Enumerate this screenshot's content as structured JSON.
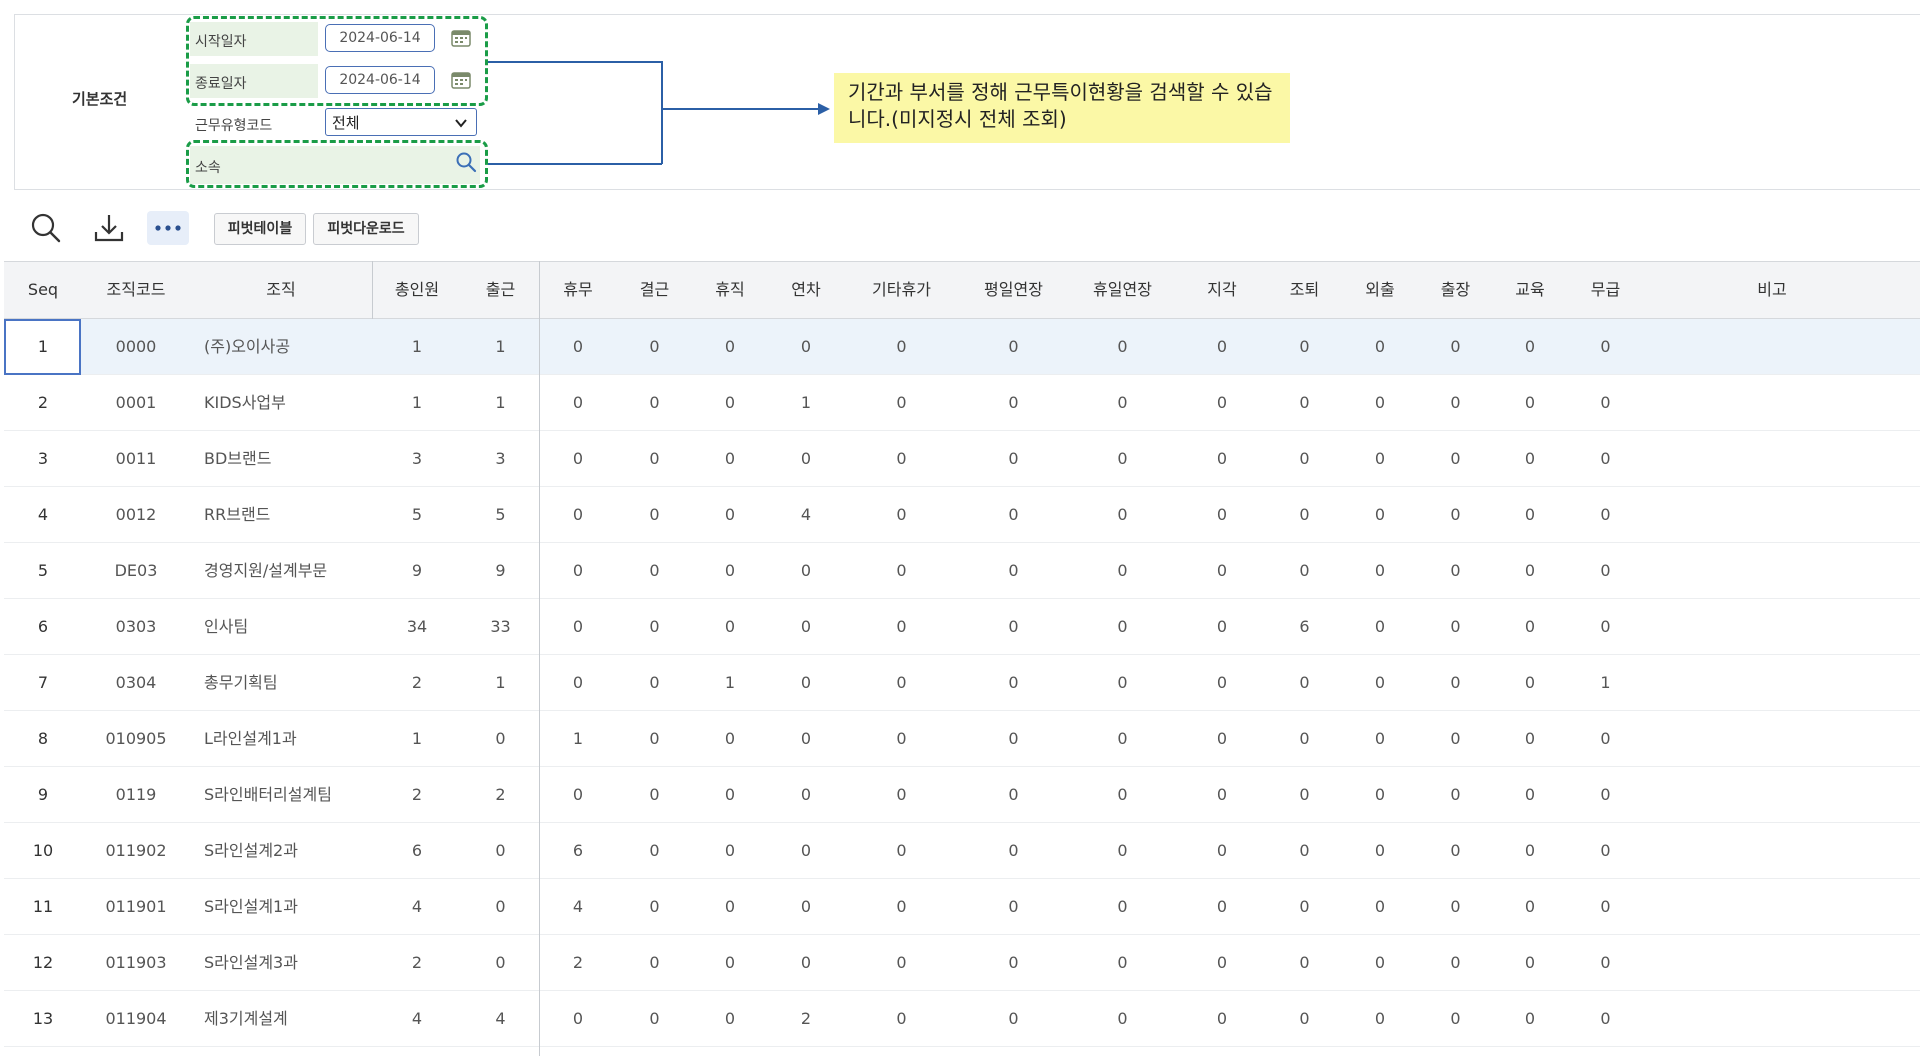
{
  "search": {
    "section_title": "기본조건",
    "start_date_label": "시작일자",
    "start_date_value": "2024-06-14",
    "end_date_label": "종료일자",
    "end_date_value": "2024-06-14",
    "work_type_label": "근무유형코드",
    "work_type_value": "전체",
    "org_label": "소속",
    "org_value": ""
  },
  "callout": {
    "text": "기간과 부서를 정해 근무특이현황을 검색할 수 있습니다.(미지정시 전체 조회)"
  },
  "toolbar": {
    "pivot_table_label": "피벗테이블",
    "pivot_download_label": "피벗다운로드"
  },
  "colors": {
    "accent_blue": "#4a6fb5",
    "highlight_green": "#1a9c47",
    "callout_yellow": "#fbf8a6",
    "selected_row": "#ecf3fa"
  },
  "grid": {
    "columns": [
      "Seq",
      "조직코드",
      "조직",
      "총인원",
      "출근",
      "휴무",
      "결근",
      "휴직",
      "연차",
      "기타휴가",
      "평일연장",
      "휴일연장",
      "지각",
      "조퇴",
      "외출",
      "출장",
      "교육",
      "무급",
      "비고"
    ],
    "rows": [
      [
        "1",
        "0000",
        "(주)오이사공",
        "1",
        "1",
        "0",
        "0",
        "0",
        "0",
        "0",
        "0",
        "0",
        "0",
        "0",
        "0",
        "0",
        "0",
        "0",
        ""
      ],
      [
        "2",
        "0001",
        "KIDS사업부",
        "1",
        "1",
        "0",
        "0",
        "0",
        "1",
        "0",
        "0",
        "0",
        "0",
        "0",
        "0",
        "0",
        "0",
        "0",
        ""
      ],
      [
        "3",
        "0011",
        "BD브랜드",
        "3",
        "3",
        "0",
        "0",
        "0",
        "0",
        "0",
        "0",
        "0",
        "0",
        "0",
        "0",
        "0",
        "0",
        "0",
        ""
      ],
      [
        "4",
        "0012",
        "RR브랜드",
        "5",
        "5",
        "0",
        "0",
        "0",
        "4",
        "0",
        "0",
        "0",
        "0",
        "0",
        "0",
        "0",
        "0",
        "0",
        ""
      ],
      [
        "5",
        "DE03",
        "경영지원/설계부문",
        "9",
        "9",
        "0",
        "0",
        "0",
        "0",
        "0",
        "0",
        "0",
        "0",
        "0",
        "0",
        "0",
        "0",
        "0",
        ""
      ],
      [
        "6",
        "0303",
        "인사팀",
        "34",
        "33",
        "0",
        "0",
        "0",
        "0",
        "0",
        "0",
        "0",
        "0",
        "6",
        "0",
        "0",
        "0",
        "0",
        ""
      ],
      [
        "7",
        "0304",
        "총무기획팀",
        "2",
        "1",
        "0",
        "0",
        "1",
        "0",
        "0",
        "0",
        "0",
        "0",
        "0",
        "0",
        "0",
        "0",
        "1",
        ""
      ],
      [
        "8",
        "010905",
        "L라인설계1과",
        "1",
        "0",
        "1",
        "0",
        "0",
        "0",
        "0",
        "0",
        "0",
        "0",
        "0",
        "0",
        "0",
        "0",
        "0",
        ""
      ],
      [
        "9",
        "0119",
        "S라인배터리설계팀",
        "2",
        "2",
        "0",
        "0",
        "0",
        "0",
        "0",
        "0",
        "0",
        "0",
        "0",
        "0",
        "0",
        "0",
        "0",
        ""
      ],
      [
        "10",
        "011902",
        "S라인설계2과",
        "6",
        "0",
        "6",
        "0",
        "0",
        "0",
        "0",
        "0",
        "0",
        "0",
        "0",
        "0",
        "0",
        "0",
        "0",
        ""
      ],
      [
        "11",
        "011901",
        "S라인설계1과",
        "4",
        "0",
        "4",
        "0",
        "0",
        "0",
        "0",
        "0",
        "0",
        "0",
        "0",
        "0",
        "0",
        "0",
        "0",
        ""
      ],
      [
        "12",
        "011903",
        "S라인설계3과",
        "2",
        "0",
        "2",
        "0",
        "0",
        "0",
        "0",
        "0",
        "0",
        "0",
        "0",
        "0",
        "0",
        "0",
        "0",
        ""
      ],
      [
        "13",
        "011904",
        "제3기계설계",
        "4",
        "4",
        "0",
        "0",
        "0",
        "2",
        "0",
        "0",
        "0",
        "0",
        "0",
        "0",
        "0",
        "0",
        "0",
        ""
      ]
    ]
  }
}
